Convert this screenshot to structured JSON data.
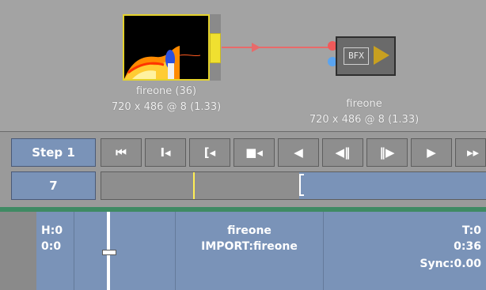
{
  "graph": {
    "source_node": {
      "name": "fireone (36)",
      "info": "720 x 486 @ 8 (1.33)"
    },
    "effect_node": {
      "badge": "BFX",
      "name": "fireone",
      "info": "720 x 486 @ 8 (1.33)"
    }
  },
  "controls": {
    "step_label": "Step 1",
    "frame_value": "7",
    "transport_icons": [
      "go-to-start-icon",
      "mark-in-icon",
      "go-to-in-icon",
      "step-back-mark-icon",
      "step-back-icon",
      "frame-back-icon",
      "frame-forward-icon",
      "play-icon",
      "fast-forward-icon"
    ],
    "transport_glyphs": [
      "⏮",
      "I◂",
      "[◂",
      "■◂",
      "◀",
      "◀‖",
      "‖▶",
      "▶",
      "▸▸"
    ]
  },
  "timeline": {
    "h_label": "H:0",
    "h_time": "0:0",
    "clip_name": "fireone",
    "clip_source": "IMPORT:fireone",
    "t_label": "T:0",
    "t_duration": "0:36",
    "sync": "Sync:0.00"
  },
  "colors": {
    "accent_blue": "#7a93b8",
    "node_highlight": "#e4d22c",
    "link_red": "#e86a6a",
    "timeline_strip": "#3f8a63"
  }
}
